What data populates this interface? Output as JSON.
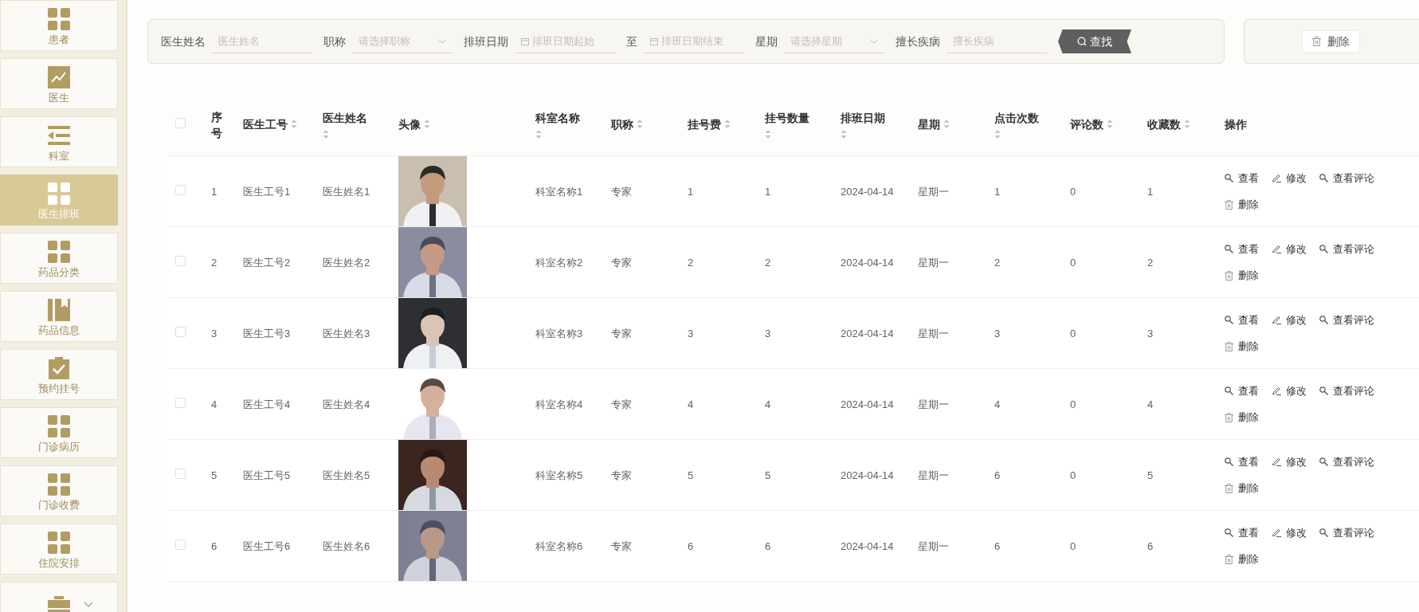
{
  "sidebar": {
    "items": [
      {
        "label": "患者",
        "kind": "grid",
        "selected": false
      },
      {
        "label": "医生",
        "kind": "chart",
        "selected": false
      },
      {
        "label": "科室",
        "kind": "indent",
        "selected": false
      },
      {
        "label": "医生排班",
        "kind": "grid",
        "selected": true
      },
      {
        "label": "药品分类",
        "kind": "grid",
        "selected": false
      },
      {
        "label": "药品信息",
        "kind": "book",
        "selected": false
      },
      {
        "label": "预约挂号",
        "kind": "clipboard",
        "selected": false
      },
      {
        "label": "门诊病历",
        "kind": "grid",
        "selected": false
      },
      {
        "label": "门诊收费",
        "kind": "grid",
        "selected": false
      },
      {
        "label": "住院安排",
        "kind": "grid",
        "selected": false
      },
      {
        "kind": "briefcase",
        "selected": false,
        "expanded": false
      }
    ]
  },
  "search": {
    "fields": [
      {
        "kind": "text",
        "label": "医生姓名",
        "placeholder": "医生姓名"
      },
      {
        "kind": "select",
        "label": "职称",
        "placeholder": "请选择职称"
      },
      {
        "kind": "date",
        "label": "排班日期",
        "placeholder": "排班日期起始"
      },
      {
        "kind": "date",
        "label": "至",
        "placeholder": "排班日期结束"
      },
      {
        "kind": "select",
        "label": "星期",
        "placeholder": "请选择星期"
      },
      {
        "kind": "text",
        "label": "擅长疾病",
        "placeholder": "擅长疾病"
      }
    ],
    "button": "查找"
  },
  "toolbar": {
    "delete_button": "删除"
  },
  "table": {
    "columns": [
      {
        "label": "序号",
        "sortable": false
      },
      {
        "label": "医生工号",
        "sortable": true
      },
      {
        "label": "医生姓名",
        "sortable": true
      },
      {
        "label": "头像",
        "sortable": true
      },
      {
        "label": "科室名称",
        "sortable": true
      },
      {
        "label": "职称",
        "sortable": true
      },
      {
        "label": "挂号费",
        "sortable": true
      },
      {
        "label": "挂号数量",
        "sortable": true
      },
      {
        "label": "排班日期",
        "sortable": true
      },
      {
        "label": "星期",
        "sortable": true
      },
      {
        "label": "点击次数",
        "sortable": true
      },
      {
        "label": "评论数",
        "sortable": true
      },
      {
        "label": "收藏数",
        "sortable": true
      },
      {
        "label": "操作",
        "sortable": false
      }
    ],
    "header_checked": false,
    "rows": [
      {
        "checked": false,
        "cells": [
          "1",
          "医生工号1",
          "医生姓名1",
          null,
          "科室名称1",
          "专家",
          "1",
          "1",
          "2024-04-14",
          "星期一",
          "1",
          "0",
          "1"
        ],
        "actions": [
          {
            "kind": "view",
            "label": "查看"
          },
          {
            "kind": "edit",
            "label": "修改"
          },
          {
            "kind": "view",
            "label": "查看评论"
          },
          {
            "kind": "delete",
            "label": "删除"
          }
        ]
      },
      {
        "checked": false,
        "cells": [
          "2",
          "医生工号2",
          "医生姓名2",
          null,
          "科室名称2",
          "专家",
          "2",
          "2",
          "2024-04-14",
          "星期一",
          "2",
          "0",
          "2"
        ],
        "actions": [
          {
            "kind": "view",
            "label": "查看"
          },
          {
            "kind": "edit",
            "label": "修改"
          },
          {
            "kind": "view",
            "label": "查看评论"
          },
          {
            "kind": "delete",
            "label": "删除"
          }
        ]
      },
      {
        "checked": false,
        "cells": [
          "3",
          "医生工号3",
          "医生姓名3",
          null,
          "科室名称3",
          "专家",
          "3",
          "3",
          "2024-04-14",
          "星期一",
          "3",
          "0",
          "3"
        ],
        "actions": [
          {
            "kind": "view",
            "label": "查看"
          },
          {
            "kind": "edit",
            "label": "修改"
          },
          {
            "kind": "view",
            "label": "查看评论"
          },
          {
            "kind": "delete",
            "label": "删除"
          }
        ]
      },
      {
        "checked": false,
        "cells": [
          "4",
          "医生工号4",
          "医生姓名4",
          null,
          "科室名称4",
          "专家",
          "4",
          "4",
          "2024-04-14",
          "星期一",
          "4",
          "0",
          "4"
        ],
        "actions": [
          {
            "kind": "view",
            "label": "查看"
          },
          {
            "kind": "edit",
            "label": "修改"
          },
          {
            "kind": "view",
            "label": "查看评论"
          },
          {
            "kind": "delete",
            "label": "删除"
          }
        ]
      },
      {
        "checked": false,
        "cells": [
          "5",
          "医生工号5",
          "医生姓名5",
          null,
          "科室名称5",
          "专家",
          "5",
          "5",
          "2024-04-14",
          "星期一",
          "6",
          "0",
          "5"
        ],
        "actions": [
          {
            "kind": "view",
            "label": "查看"
          },
          {
            "kind": "edit",
            "label": "修改"
          },
          {
            "kind": "view",
            "label": "查看评论"
          },
          {
            "kind": "delete",
            "label": "删除"
          }
        ]
      },
      {
        "checked": false,
        "cells": [
          "6",
          "医生工号6",
          "医生姓名6",
          null,
          "科室名称6",
          "专家",
          "6",
          "6",
          "2024-04-14",
          "星期一",
          "6",
          "0",
          "6"
        ],
        "actions": [
          {
            "kind": "view",
            "label": "查看"
          },
          {
            "kind": "edit",
            "label": "修改"
          },
          {
            "kind": "view",
            "label": "查看评论"
          },
          {
            "kind": "delete",
            "label": "删除"
          }
        ]
      }
    ]
  }
}
